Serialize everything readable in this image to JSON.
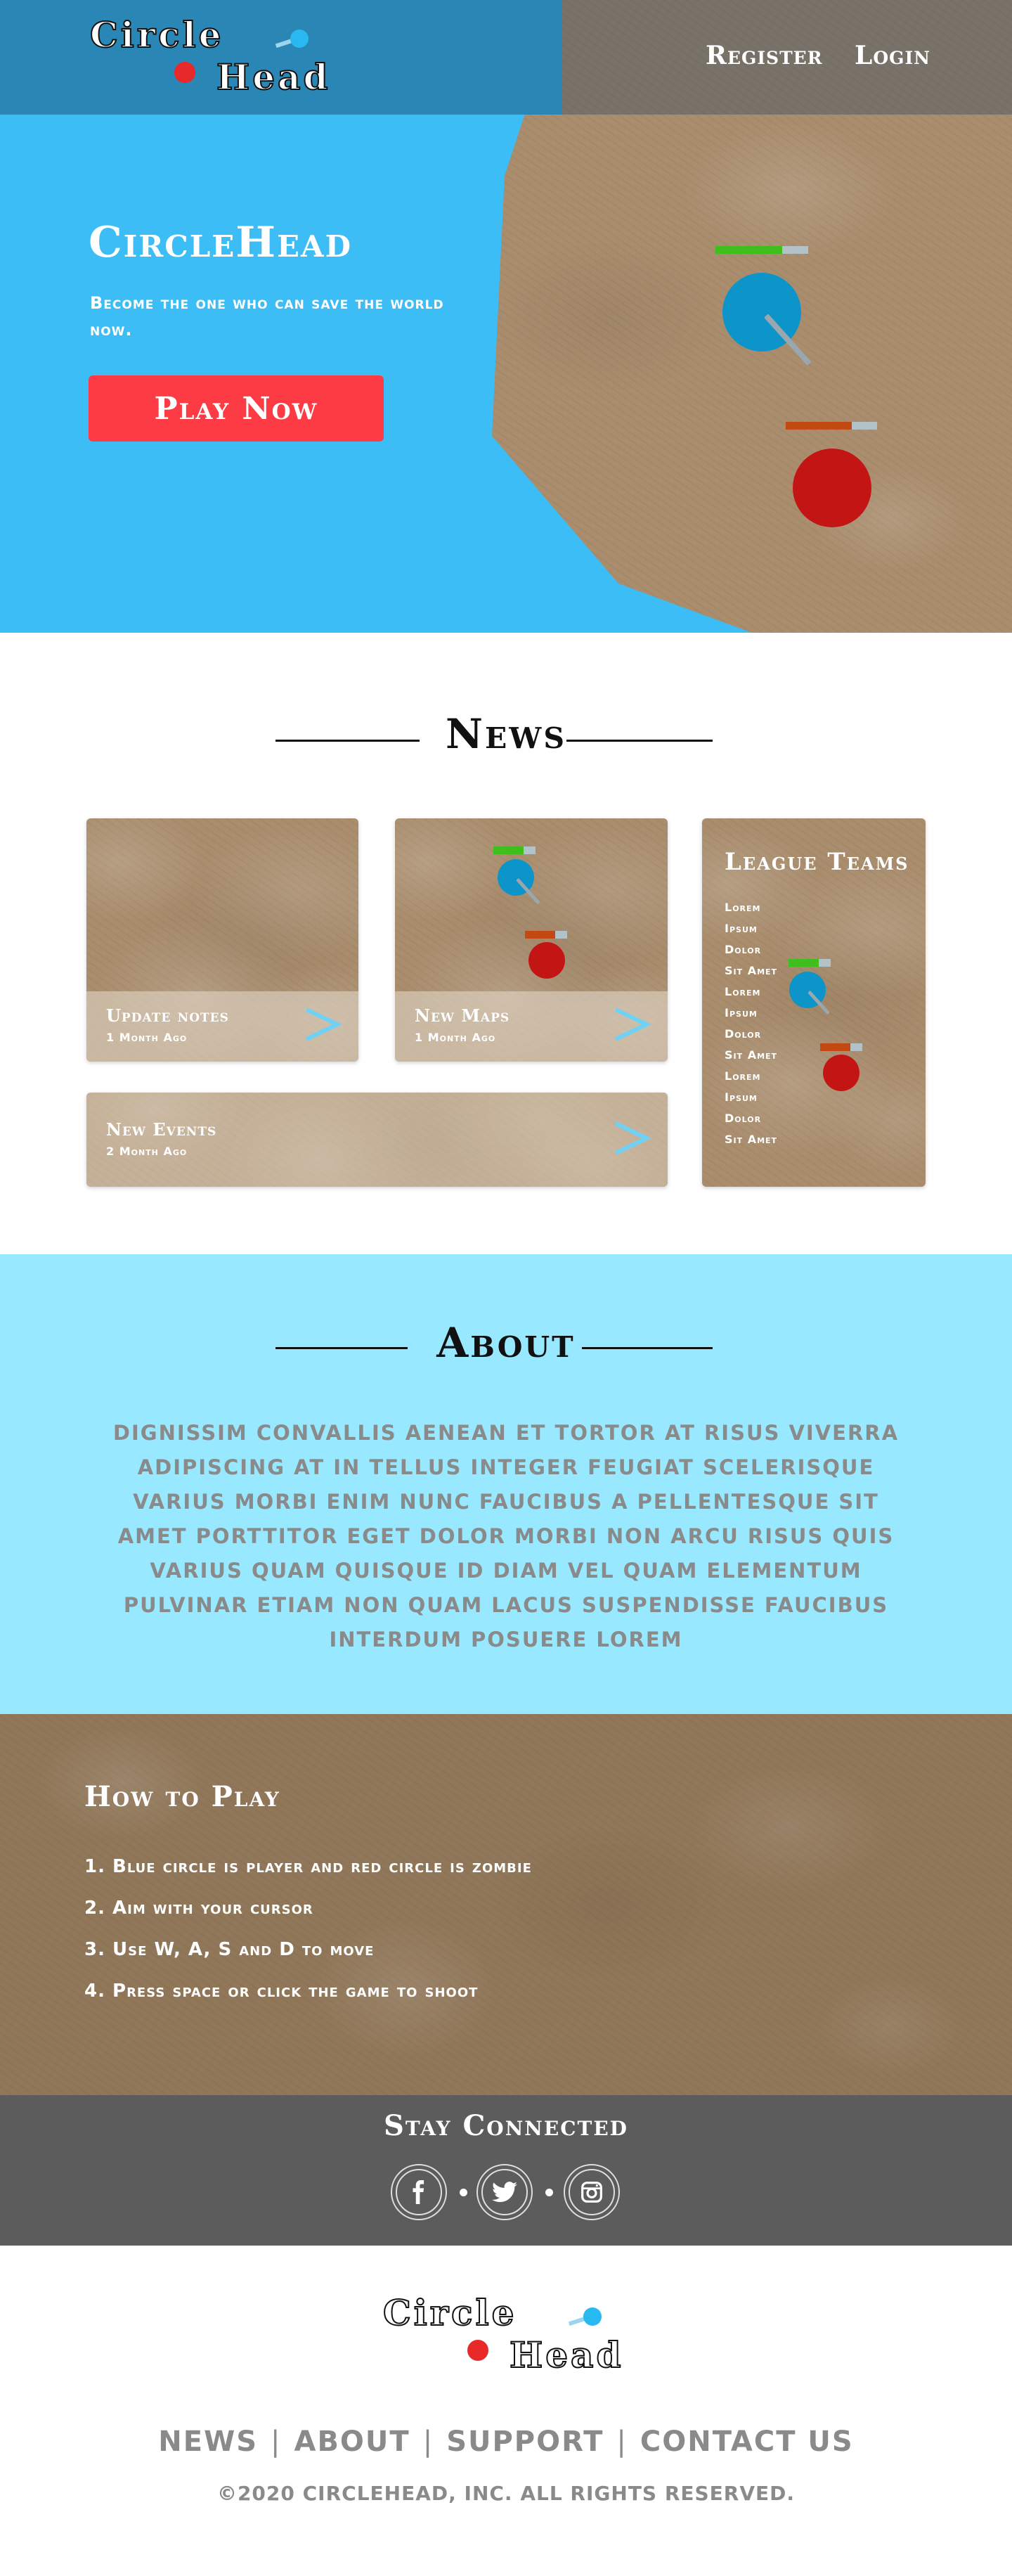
{
  "brand": {
    "word1": "Circle",
    "word2": "Head"
  },
  "nav": {
    "register": "Register",
    "login": "Login"
  },
  "hero": {
    "title": "CircleHead",
    "subtitle": "Become the one who can save the world now.",
    "cta": "Play Now"
  },
  "news": {
    "title": "News",
    "cards": [
      {
        "title": "Update notes",
        "meta": "1 Month Ago"
      },
      {
        "title": "New Maps",
        "meta": "1 Month Ago"
      },
      {
        "title": "New Events",
        "meta": "2 Month Ago"
      }
    ],
    "league": {
      "title": "League Teams",
      "teams": [
        "Lorem",
        "Ipsum",
        "Dolor",
        "Sit Amet",
        "Lorem",
        "Ipsum",
        "Dolor",
        "Sit Amet",
        "Lorem",
        "Ipsum",
        "Dolor",
        "Sit Amet"
      ]
    }
  },
  "about": {
    "title": "About",
    "text": "Dignissim convallis aenean et tortor at risus viverra adipiscing at in tellus integer feugiat scelerisque varius morbi enim nunc faucibus a pellentesque sit amet porttitor eget dolor morbi non arcu risus quis varius quam quisque id diam vel quam elementum pulvinar etiam non quam lacus suspendisse faucibus interdum posuere lorem"
  },
  "howto": {
    "title": "How to Play",
    "steps": [
      "1. Blue circle is player and red circle is zombie",
      "2. Aim with your cursor",
      "3. Use W, A, S and D to move",
      "4. Press space or click the game to shoot"
    ]
  },
  "connect": {
    "title": "Stay Connected",
    "icons": [
      "facebook-icon",
      "twitter-icon",
      "instagram-icon"
    ]
  },
  "footer": {
    "links": [
      "NEWS",
      "ABOUT",
      "SUPPORT",
      "CONTACT US"
    ],
    "copyright": "©2020 CIRCLEHEAD, INC. ALL RIGHTS RESERVED."
  },
  "colors": {
    "hero_blue": "#3cbdf6",
    "header_blue": "#2a86b4",
    "cta_red": "#fc3b44",
    "player_blue": "#0d95c9",
    "zombie_red": "#c41515",
    "about_bg": "#98e8ff",
    "connect_bg": "#5c5c5c",
    "footer_text": "#8a8a8a"
  },
  "health": {
    "player": 0.72,
    "zombie": 0.72
  }
}
